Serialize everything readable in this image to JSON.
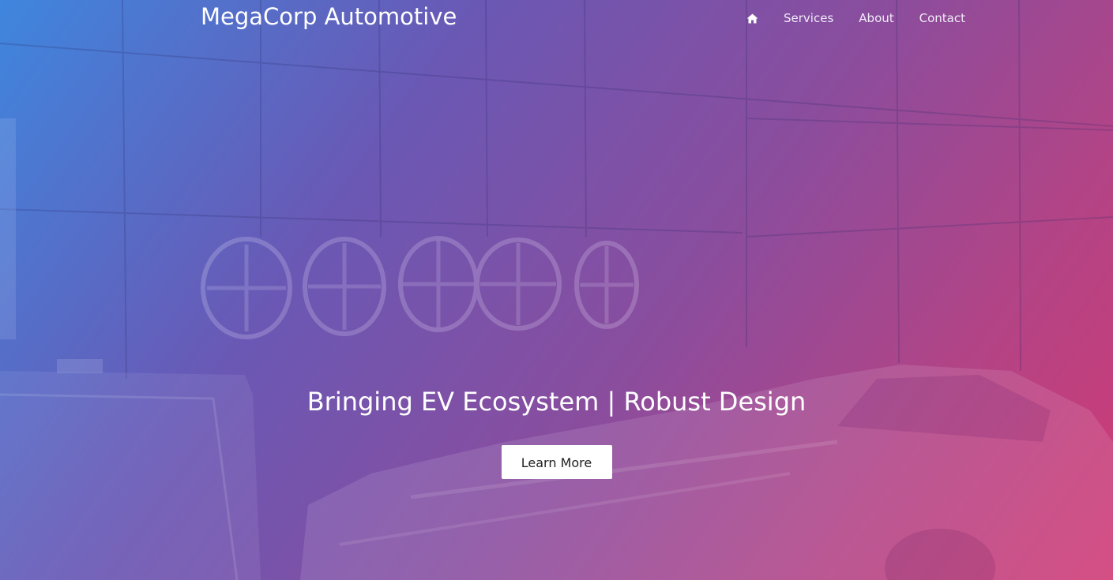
{
  "navbar": {
    "brand": "MegaCorp Automotive",
    "home_icon": "home-icon",
    "links": [
      {
        "label": "Services"
      },
      {
        "label": "About"
      },
      {
        "label": "Contact"
      }
    ]
  },
  "hero": {
    "headline": "Bringing EV Ecosystem | Robust Design",
    "cta_label": "Learn More",
    "background": "showroom photo with wheels on wall and white sports car",
    "overlay_gradient": [
      "#3f86de",
      "#6a58b4",
      "#8a4d9e",
      "#b24486",
      "#d03a74"
    ]
  }
}
